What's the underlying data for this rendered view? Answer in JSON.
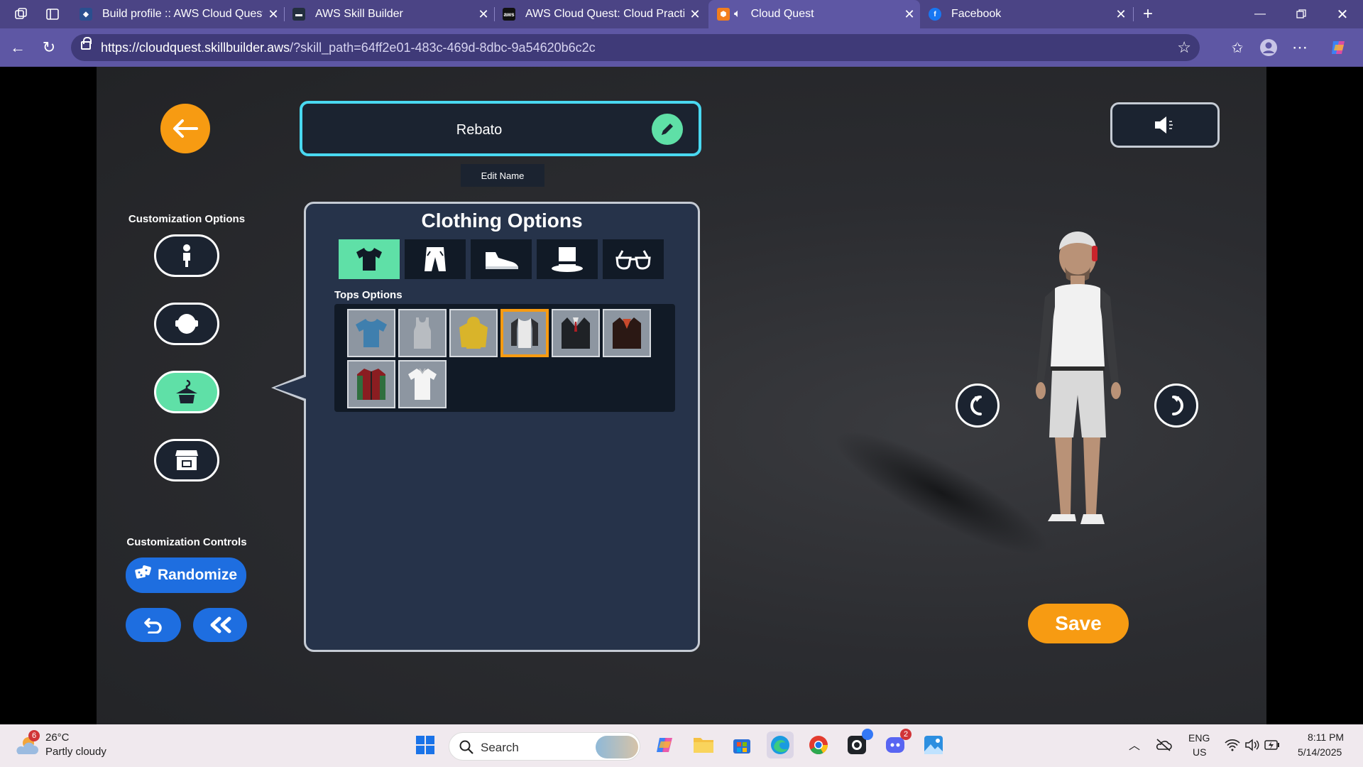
{
  "browser": {
    "tabs": [
      {
        "title": "Build profile :: AWS Cloud Quest: C",
        "active": false
      },
      {
        "title": "AWS Skill Builder",
        "active": false
      },
      {
        "title": "AWS Cloud Quest: Cloud Practitio",
        "active": false
      },
      {
        "title": "Cloud Quest",
        "active": true
      },
      {
        "title": "Facebook",
        "active": false
      }
    ],
    "url_host": "https://cloudquest.skillbuilder.aws",
    "url_path": "/?skill_path=64ff2e01-483c-469d-8dbc-9a54620b6c2c"
  },
  "game": {
    "player_name": "Rebato",
    "edit_name_label": "Edit Name",
    "customization_options_label": "Customization Options",
    "customization_controls_label": "Customization Controls",
    "randomize_label": "Randomize",
    "save_label": "Save",
    "panel": {
      "title": "Clothing Options",
      "categories": [
        "tops",
        "pants",
        "shoes",
        "hats",
        "glasses"
      ],
      "selected_category": "tops",
      "tops_label": "Tops Options",
      "tops_items": [
        {
          "name": "blue-tshirt",
          "color": "#3f7fae"
        },
        {
          "name": "gray-tanktop",
          "color": "#a9adb2"
        },
        {
          "name": "yellow-hoodie",
          "color": "#d9b42a"
        },
        {
          "name": "raglan-shirt",
          "color": "#e6e6e6",
          "selected": true
        },
        {
          "name": "black-suit",
          "color": "#1f2226"
        },
        {
          "name": "red-jacket",
          "color": "#6b2a1f"
        },
        {
          "name": "red-green-jacket",
          "color": "#8a1d21"
        },
        {
          "name": "white-shirt",
          "color": "#f2f2f2"
        }
      ]
    }
  },
  "taskbar": {
    "weather_temp": "26°C",
    "weather_desc": "Partly cloudy",
    "weather_badge": "6",
    "search_placeholder": "Search",
    "lang": "ENG",
    "region": "US",
    "time": "8:11 PM",
    "date": "5/14/2025",
    "badges": {
      "github": "",
      "discord": "2"
    }
  }
}
